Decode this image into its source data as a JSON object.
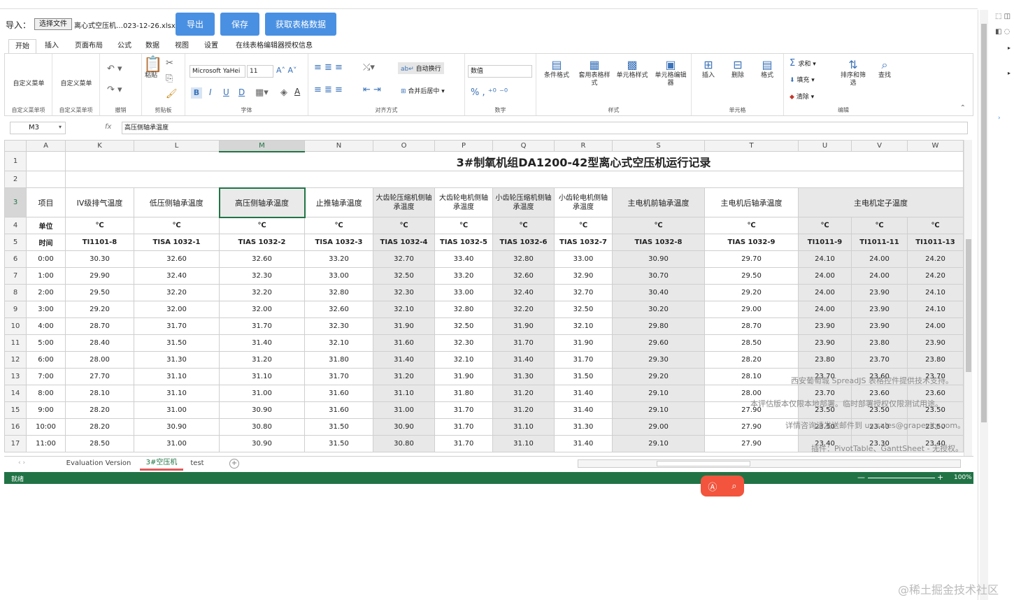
{
  "toolbar": {
    "import_label": "导入：",
    "choose_file": "选择文件",
    "file_name": "离心式空压机…023-12-26.xlsx",
    "export": "导出",
    "save": "保存",
    "get_data": "获取表格数据"
  },
  "tabs": [
    "开始",
    "插入",
    "页面布局",
    "公式",
    "数据",
    "视图",
    "设置",
    "在线表格编辑器授权信息"
  ],
  "ribbon": {
    "custom1": "自定义菜单",
    "custom2": "自定义菜单",
    "grp_custom1": "自定义菜单项",
    "grp_custom2": "自定义菜单项",
    "grp_undo": "撤销",
    "paste": "粘贴",
    "grp_clip": "剪贴板",
    "font_name": "Microsoft YaHei",
    "font_size": "11",
    "grp_font": "字体",
    "wrap": "自动换行",
    "merge": "合并后居中",
    "grp_align": "对齐方式",
    "num_format": "数值",
    "grp_number": "数字",
    "cond": "条件格式",
    "table_style": "套用表格样式",
    "cell_style": "单元格样式",
    "cell_editor": "单元格编辑器",
    "grp_style": "样式",
    "insert": "插入",
    "delete": "删除",
    "format": "格式",
    "grp_cells": "单元格",
    "sum": "求和",
    "fill": "填充",
    "clear": "清除",
    "sort": "排序和筛选",
    "find": "查找",
    "grp_edit": "编辑"
  },
  "formula": {
    "cell_ref": "M3",
    "fx": "fx",
    "content": "高压侧轴承温度"
  },
  "sheet": {
    "title": "3#制氧机组DA1200-42型离心式空压机运行记录",
    "cols": [
      "A",
      "K",
      "L",
      "M",
      "N",
      "O",
      "P",
      "Q",
      "R",
      "S",
      "T",
      "U",
      "V",
      "W"
    ],
    "headers": [
      "项目",
      "IV级排气温度",
      "低压侧轴承温度",
      "高压侧轴承温度",
      "止推轴承温度",
      "大齿轮压缩机侧轴承温度",
      "大齿轮电机侧轴承温度",
      "小齿轮压缩机侧轴承温度",
      "小齿轮电机侧轴承温度",
      "主电机前轴承温度",
      "主电机后轴承温度",
      "主电机定子温度"
    ],
    "units": [
      "单位",
      "℃",
      "℃",
      "℃",
      "℃",
      "℃",
      "℃",
      "℃",
      "℃",
      "℃",
      "℃",
      "℃",
      "℃",
      "℃"
    ],
    "tags": [
      "时间",
      "TI1101-8",
      "TISA 1032-1",
      "TIAS 1032-2",
      "TISA 1032-3",
      "TIAS 1032-4",
      "TIAS 1032-5",
      "TIAS 1032-6",
      "TIAS 1032-7",
      "TIAS 1032-8",
      "TIAS 1032-9",
      "TI1011-9",
      "TI1011-11",
      "TI1011-13"
    ],
    "rows": [
      [
        "0:00",
        "30.30",
        "32.60",
        "32.60",
        "33.20",
        "32.70",
        "33.40",
        "32.80",
        "33.00",
        "30.90",
        "29.70",
        "24.10",
        "24.00",
        "24.20"
      ],
      [
        "1:00",
        "29.90",
        "32.40",
        "32.30",
        "33.00",
        "32.50",
        "33.20",
        "32.60",
        "32.90",
        "30.70",
        "29.50",
        "24.00",
        "24.00",
        "24.20"
      ],
      [
        "2:00",
        "29.50",
        "32.20",
        "32.20",
        "32.80",
        "32.30",
        "33.00",
        "32.40",
        "32.70",
        "30.40",
        "29.20",
        "24.00",
        "23.90",
        "24.10"
      ],
      [
        "3:00",
        "29.20",
        "32.00",
        "32.00",
        "32.60",
        "32.10",
        "32.80",
        "32.20",
        "32.50",
        "30.20",
        "29.00",
        "24.00",
        "23.90",
        "24.10"
      ],
      [
        "4:00",
        "28.70",
        "31.70",
        "31.70",
        "32.30",
        "31.90",
        "32.50",
        "31.90",
        "32.10",
        "29.80",
        "28.70",
        "23.90",
        "23.90",
        "24.00"
      ],
      [
        "5:00",
        "28.40",
        "31.50",
        "31.40",
        "32.10",
        "31.60",
        "32.30",
        "31.70",
        "31.90",
        "29.60",
        "28.50",
        "23.90",
        "23.80",
        "23.90"
      ],
      [
        "6:00",
        "28.00",
        "31.30",
        "31.20",
        "31.80",
        "31.40",
        "32.10",
        "31.40",
        "31.70",
        "29.30",
        "28.20",
        "23.80",
        "23.70",
        "23.80"
      ],
      [
        "7:00",
        "27.70",
        "31.10",
        "31.10",
        "31.70",
        "31.20",
        "31.90",
        "31.30",
        "31.50",
        "29.20",
        "28.10",
        "23.70",
        "23.60",
        "23.70"
      ],
      [
        "8:00",
        "28.10",
        "31.10",
        "31.00",
        "31.60",
        "31.10",
        "31.80",
        "31.20",
        "31.40",
        "29.10",
        "28.00",
        "23.70",
        "23.60",
        "23.60"
      ],
      [
        "9:00",
        "28.20",
        "31.00",
        "30.90",
        "31.60",
        "31.00",
        "31.70",
        "31.20",
        "31.40",
        "29.10",
        "27.90",
        "23.50",
        "23.50",
        "23.50"
      ],
      [
        "10:00",
        "28.20",
        "30.90",
        "30.80",
        "31.50",
        "30.90",
        "31.70",
        "31.10",
        "31.30",
        "29.00",
        "27.90",
        "23.50",
        "23.40",
        "23.50"
      ],
      [
        "11:00",
        "28.50",
        "31.00",
        "30.90",
        "31.50",
        "30.80",
        "31.70",
        "31.10",
        "31.40",
        "29.10",
        "27.90",
        "23.40",
        "23.30",
        "23.40"
      ]
    ],
    "row_numbers": [
      "1",
      "2",
      "3",
      "4",
      "5",
      "6",
      "7",
      "8",
      "9",
      "10",
      "11",
      "12",
      "13",
      "14",
      "15",
      "16",
      "17"
    ]
  },
  "sheet_tabs": [
    "Evaluation Version",
    "3#空压机",
    "test"
  ],
  "status": {
    "ready": "就绪",
    "zoom": "100%"
  },
  "watermark": {
    "line1": "西安葡萄城 SpreadJS 表格控件提供技术支持。",
    "line2": "本评估版本仅限本地部署。临时部署授权仅限测试用途。",
    "line3": "详情咨询请发送邮件到 us.sales@grapecity.com。",
    "line4": "插件：PivotTable、GanttSheet - 无授权。",
    "site": "@稀土掘金技术社区"
  }
}
